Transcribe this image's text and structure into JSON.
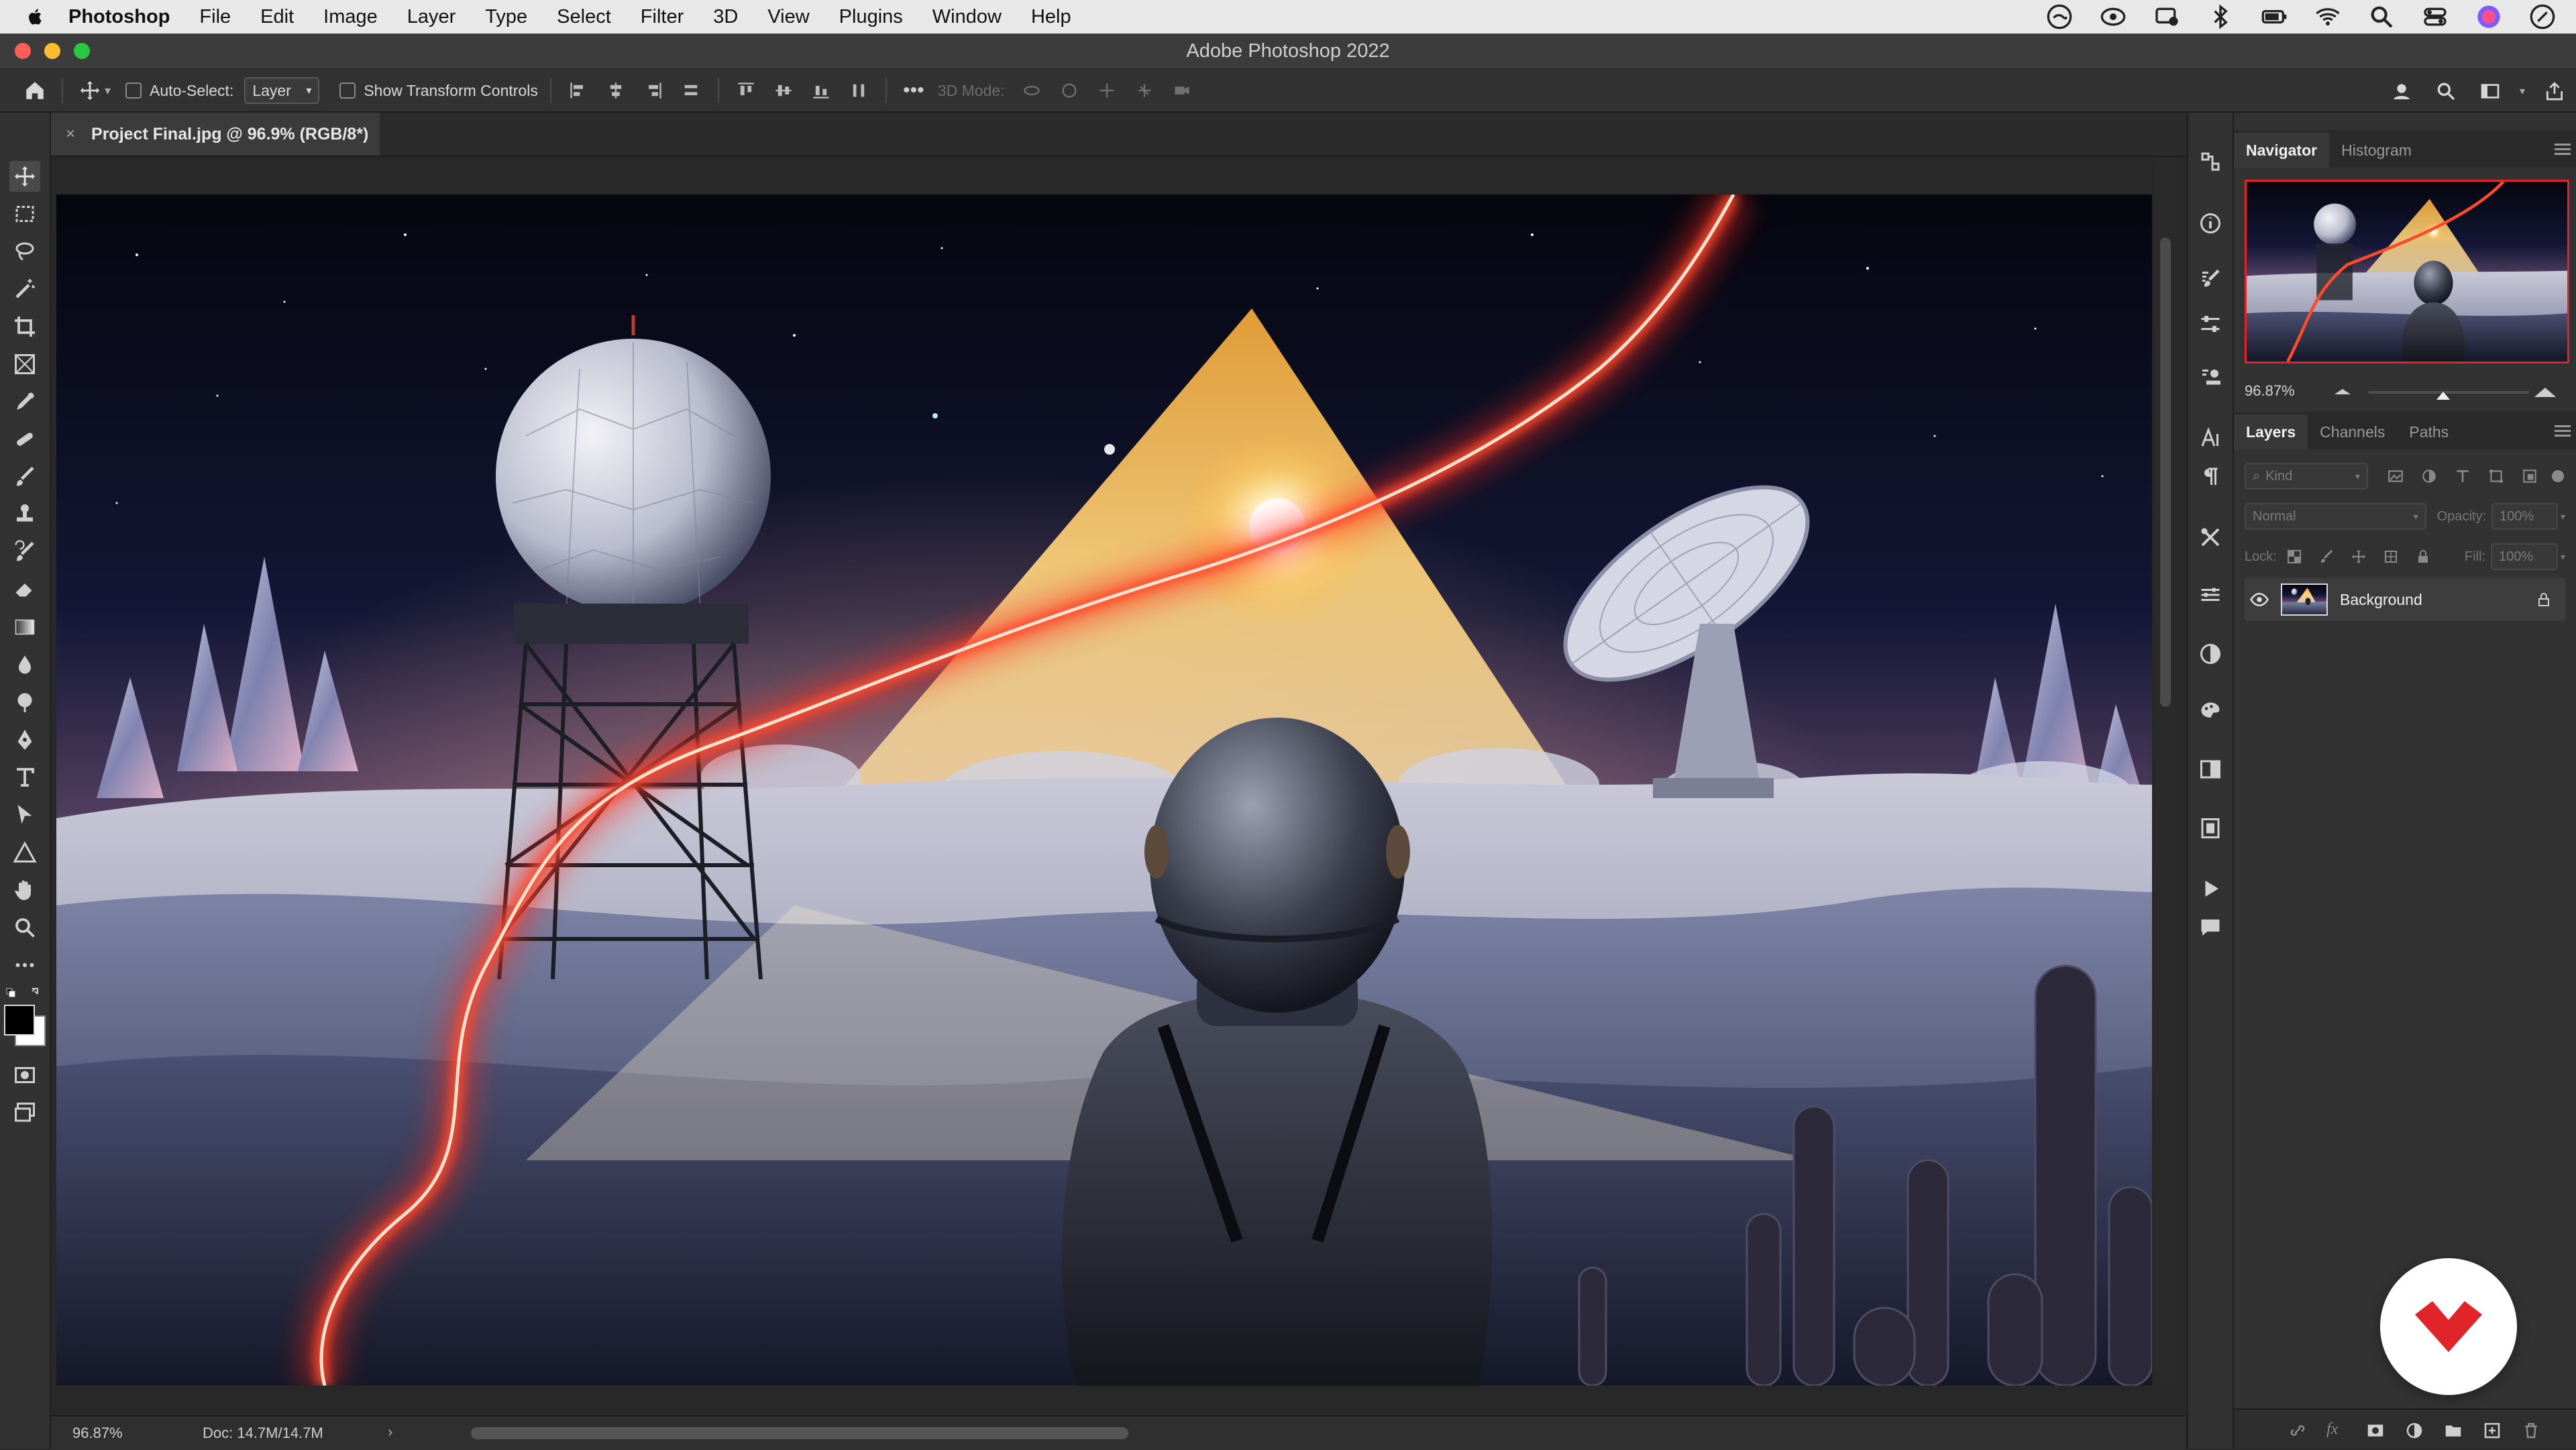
{
  "menubar": {
    "app_name": "Photoshop",
    "items": [
      "File",
      "Edit",
      "Image",
      "Layer",
      "Type",
      "Select",
      "Filter",
      "3D",
      "View",
      "Plugins",
      "Window",
      "Help"
    ]
  },
  "window": {
    "title": "Adobe Photoshop 2022"
  },
  "options_bar": {
    "auto_select_label": "Auto-Select:",
    "auto_select_value": "Layer",
    "show_transform_label": "Show Transform Controls",
    "three_d_mode_label": "3D Mode:"
  },
  "document": {
    "tab_title": "Project Final.jpg @ 96.9% (RGB/8*)",
    "close_glyph": "×"
  },
  "status_bar": {
    "zoom": "96.87%",
    "doc_size": "Doc: 14.7M/14.7M",
    "arrow": "›"
  },
  "navigator": {
    "tabs": [
      "Navigator",
      "Histogram"
    ],
    "zoom": "96.87%"
  },
  "layers_panel": {
    "tabs": [
      "Layers",
      "Channels",
      "Paths"
    ],
    "filter_placeholder": "Kind",
    "blend_mode": "Normal",
    "opacity_label": "Opacity:",
    "opacity_value": "100%",
    "lock_label": "Lock:",
    "fill_label": "Fill:",
    "fill_value": "100%",
    "layers": [
      {
        "name": "Background",
        "visible": true,
        "locked": true
      }
    ]
  },
  "colors": {
    "accent_red": "#e0242a",
    "panel_bg": "#323232",
    "canvas_bg": "#282828"
  }
}
